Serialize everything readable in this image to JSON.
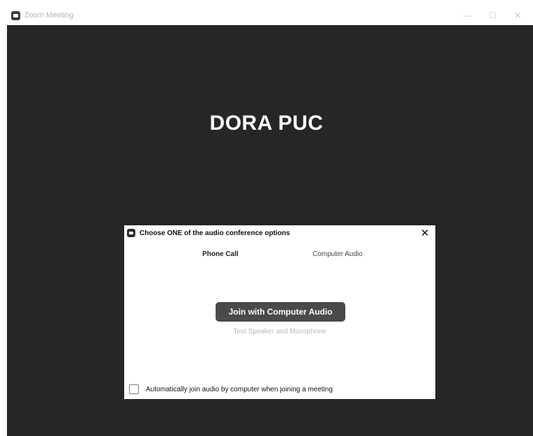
{
  "window": {
    "title": "Zoom Meeting",
    "controls": {
      "minimize": "—",
      "maximize": "☐",
      "close": "✕"
    }
  },
  "meeting": {
    "participant_name": "DORA PUC"
  },
  "audio_dialog": {
    "title": "Choose ONE of the audio conference options",
    "close_symbol": "✕",
    "tabs": [
      {
        "label": "Phone Call"
      },
      {
        "label": "Computer Audio"
      }
    ],
    "join_button": "Join with Computer Audio",
    "test_link": "Test Speaker and Microphone",
    "auto_join_label": "Automatically join audio by computer when joining a meeting",
    "auto_join_checked": false
  }
}
